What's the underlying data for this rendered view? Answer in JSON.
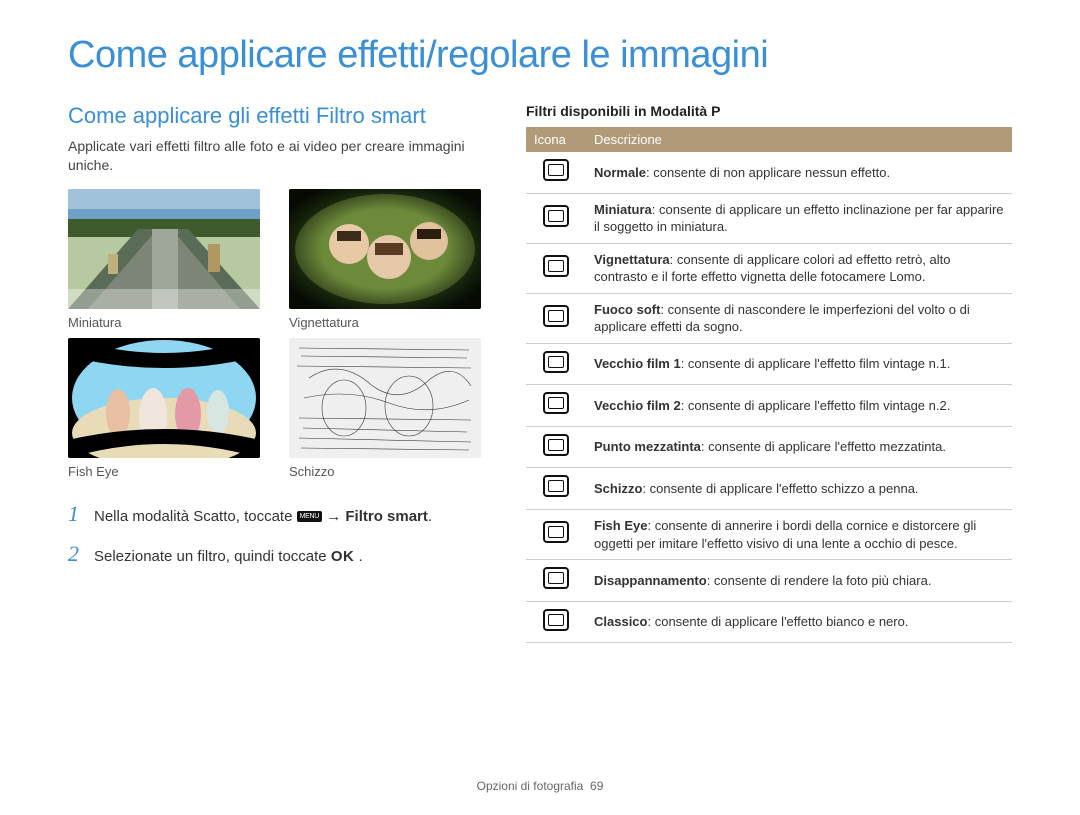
{
  "title": "Come applicare effetti/regolare le immagini",
  "left": {
    "subhead": "Come applicare gli effetti Filtro smart",
    "intro": "Applicate vari effetti filtro alle foto e ai video per creare immagini uniche.",
    "thumbs": [
      {
        "caption": "Miniatura"
      },
      {
        "caption": "Vignettatura"
      },
      {
        "caption": "Fish Eye"
      },
      {
        "caption": "Schizzo"
      }
    ],
    "steps": {
      "s1_pre": "Nella modalità Scatto, toccate ",
      "s1_icon": "MENU",
      "s1_arrow": "→",
      "s1_bold": "Filtro smart",
      "s1_end": ".",
      "s2_pre": "Selezionate un filtro, quindi toccate ",
      "s2_ok": "OK",
      "s2_end": "."
    }
  },
  "right": {
    "heading": "Filtri disponibili in Modalità P",
    "th_icon": "Icona",
    "th_desc": "Descrizione",
    "rows": [
      {
        "name": "Normale",
        "desc": ": consente di non applicare nessun effetto."
      },
      {
        "name": "Miniatura",
        "desc": ": consente di applicare un effetto inclinazione per far apparire il soggetto in miniatura."
      },
      {
        "name": "Vignettatura",
        "desc": ": consente di applicare colori ad effetto retrò, alto contrasto e il forte effetto vignetta delle fotocamere Lomo."
      },
      {
        "name": "Fuoco soft",
        "desc": ": consente di nascondere le imperfezioni del volto o di applicare effetti da sogno."
      },
      {
        "name": "Vecchio film 1",
        "desc": ": consente di applicare l'effetto film vintage n.1."
      },
      {
        "name": "Vecchio film 2",
        "desc": ": consente di applicare l'effetto film vintage n.2."
      },
      {
        "name": "Punto mezzatinta",
        "desc": ": consente di applicare l'effetto mezzatinta."
      },
      {
        "name": "Schizzo",
        "desc": ": consente di applicare l'effetto schizzo a penna."
      },
      {
        "name": "Fish Eye",
        "desc": ": consente di annerire i bordi della cornice e distorcere gli oggetti per imitare l'effetto visivo di una lente a occhio di pesce."
      },
      {
        "name": "Disappannamento",
        "desc": ": consente di rendere la foto più chiara."
      },
      {
        "name": "Classico",
        "desc": ": consente di applicare l'effetto bianco e nero."
      }
    ]
  },
  "footer": {
    "section": "Opzioni di fotografia",
    "page": "69"
  }
}
